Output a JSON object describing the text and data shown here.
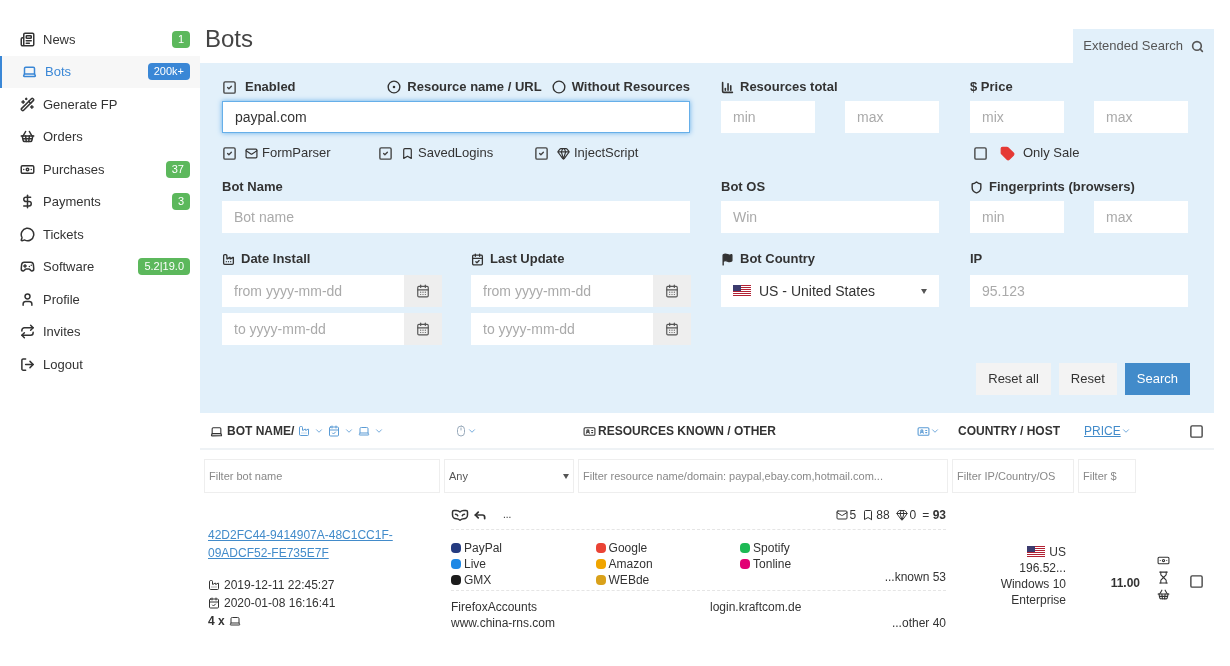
{
  "sidebar": {
    "items": [
      {
        "label": "News",
        "selected": false,
        "badge": {
          "text": "1",
          "color": "#5cb85c"
        }
      },
      {
        "label": "Bots",
        "selected": true,
        "badge": {
          "text": "200k+",
          "color": "#3a87d6"
        }
      },
      {
        "label": "Generate FP",
        "selected": false
      },
      {
        "label": "Orders",
        "selected": false
      },
      {
        "label": "Purchases",
        "selected": false,
        "badge": {
          "text": "37",
          "color": "#5cb85c"
        }
      },
      {
        "label": "Payments",
        "selected": false,
        "badge": {
          "text": "3",
          "color": "#5cb85c"
        }
      },
      {
        "label": "Tickets",
        "selected": false
      },
      {
        "label": "Software",
        "selected": false,
        "badge": {
          "text": "5.2|19.0",
          "color": "#5cb85c"
        }
      },
      {
        "label": "Profile",
        "selected": false
      },
      {
        "label": "Invites",
        "selected": false
      },
      {
        "label": "Logout",
        "selected": false
      }
    ]
  },
  "page_title": "Bots",
  "extended_search": {
    "label": "Extended Search"
  },
  "filters": {
    "enabled": {
      "label": "Enabled",
      "checked": true
    },
    "resource_mode": [
      {
        "label": "Resource name / URL",
        "selected": true
      },
      {
        "label": "Without Resources",
        "selected": false
      }
    ],
    "resource": {
      "value": "paypal.com"
    },
    "resource_types": [
      {
        "label": "FormParser",
        "checked": true
      },
      {
        "label": "SavedLogins",
        "checked": true
      },
      {
        "label": "InjectScript",
        "checked": true
      }
    ],
    "resources_total": {
      "label": "Resources total",
      "min": {
        "placeholder": "min"
      },
      "max": {
        "placeholder": "max"
      }
    },
    "price": {
      "label": "$ Price",
      "min": {
        "placeholder": "mix"
      },
      "max": {
        "placeholder": "max"
      }
    },
    "only_sale": {
      "label": "Only Sale",
      "checked": false
    },
    "bot_name": {
      "label": "Bot Name",
      "placeholder": "Bot name"
    },
    "bot_os": {
      "label": "Bot OS",
      "placeholder": "Win"
    },
    "fingerprints": {
      "label": "Fingerprints (browsers)",
      "min": {
        "placeholder": "min"
      },
      "max": {
        "placeholder": "max"
      }
    },
    "date_install": {
      "label": "Date Install",
      "from": {
        "placeholder": "from yyyy-mm-dd"
      },
      "to": {
        "placeholder": "to yyyy-mm-dd"
      }
    },
    "last_update": {
      "label": "Last Update",
      "from": {
        "placeholder": "from yyyy-mm-dd"
      },
      "to": {
        "placeholder": "to yyyy-mm-dd"
      }
    },
    "bot_country": {
      "label": "Bot Country",
      "value": "US - United States"
    },
    "ip": {
      "label": "IP",
      "placeholder": "95.123"
    },
    "buttons": [
      {
        "label": "Reset all",
        "kind": "default"
      },
      {
        "label": "Reset",
        "kind": "default"
      },
      {
        "label": "Search",
        "kind": "primary"
      }
    ]
  },
  "table": {
    "columns": {
      "bot_name": "BOT NAME/",
      "resources": "RESOURCES KNOWN / OTHER",
      "country": "COUNTRY / HOST",
      "price": "PRICE"
    },
    "select_all": {
      "checked": false
    },
    "filter_row": {
      "bot_name": {
        "placeholder": "Filter bot name"
      },
      "browser": {
        "value": "Any"
      },
      "resource": {
        "placeholder": "Filter resource name/domain: paypal,ebay.com,hotmail.com..."
      },
      "country": {
        "placeholder": "Filter IP/Country/OS"
      },
      "price": {
        "placeholder": "Filter $"
      }
    },
    "rows": [
      {
        "name": "42D2FC44-9414907A-48C1CC1F-09ADCF52-FE735E7F",
        "installed": "2019-12-11 22:45:27",
        "updated": "2020-01-08 16:16:41",
        "devices": "4 x",
        "more": "...",
        "counts": {
          "forms": "5",
          "logins": "88",
          "injects": "0",
          "total": "= **93**"
        },
        "known": [
          [
            {
              "name": "PayPal",
              "color": "#253b80"
            },
            {
              "name": "Live",
              "color": "#1e88e5"
            },
            {
              "name": "GMX",
              "color": "#1c1c1c"
            }
          ],
          [
            {
              "name": "Google",
              "color": "#ea4335"
            },
            {
              "name": "Amazon",
              "color": "#f0a500"
            },
            {
              "name": "WEBde",
              "color": "#d9a11a"
            }
          ],
          [
            {
              "name": "Spotify",
              "color": "#1db954"
            },
            {
              "name": "Tonline",
              "color": "#e20074"
            }
          ]
        ],
        "known_more": "...known 53",
        "other": [
          "FirefoxAccounts",
          "login.kraftcom.de",
          "www.china-rns.com"
        ],
        "other_more": "...other 40",
        "country": "US",
        "host": "196.52...",
        "os": "Windows 10 Enterprise",
        "price": "11.00",
        "selected": false
      }
    ]
  }
}
